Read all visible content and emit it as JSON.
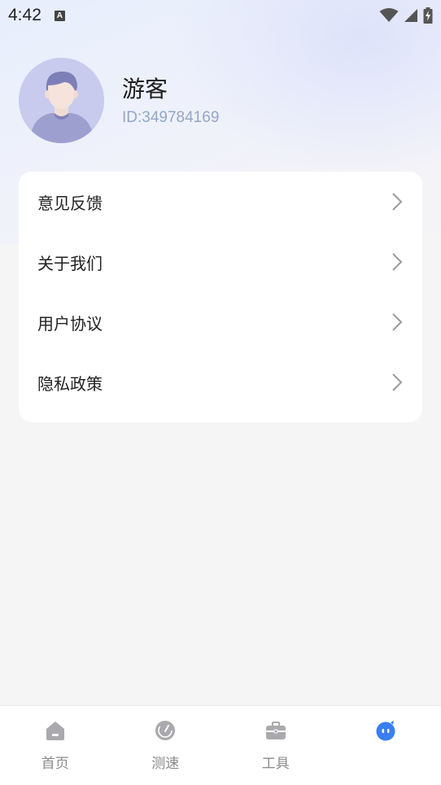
{
  "status_bar": {
    "time": "4:42",
    "notification_letter": "A"
  },
  "profile": {
    "nickname": "游客",
    "user_id": "ID:349784169"
  },
  "menu": [
    {
      "label": "意见反馈"
    },
    {
      "label": "关于我们"
    },
    {
      "label": "用户协议"
    },
    {
      "label": "隐私政策"
    }
  ],
  "tabs": [
    {
      "label": "首页",
      "icon": "home-icon",
      "active": false
    },
    {
      "label": "测速",
      "icon": "speedometer-icon",
      "active": false
    },
    {
      "label": "工具",
      "icon": "toolbox-icon",
      "active": false
    },
    {
      "label": "",
      "icon": "profile-face-icon",
      "active": true
    }
  ],
  "colors": {
    "accent": "#3a7ef0",
    "inactive_icon": "#a9a9ae",
    "id_text": "#93a6c6"
  }
}
